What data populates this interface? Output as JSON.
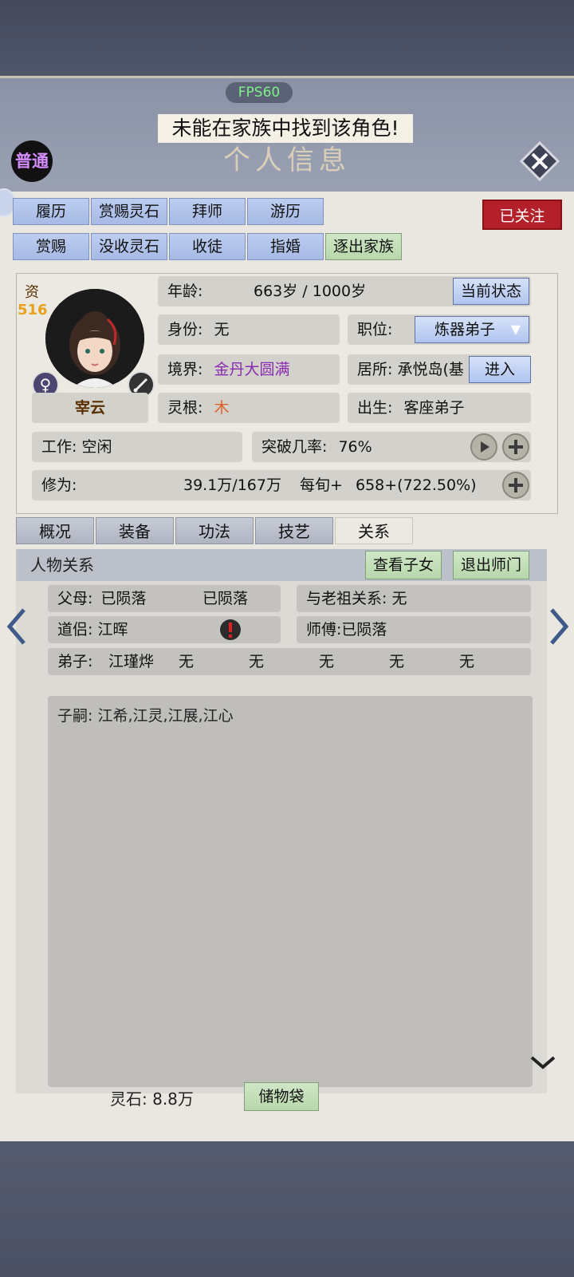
{
  "fps": "FPS60",
  "toast": "未能在家族中找到该角色!",
  "title": "个人信息",
  "rank_badge": "普通",
  "followed_label": "已关注",
  "action_row1": [
    "履历",
    "赏赐灵石",
    "拜师",
    "游历"
  ],
  "action_row2": [
    "赏赐",
    "没收灵石",
    "收徒",
    "指婚",
    "逐出家族"
  ],
  "char": {
    "zi_label": "资",
    "zi_value": "516",
    "name": "宰云",
    "sex_icon": "♀",
    "age_label": "年龄:",
    "age_value": "663岁 / 1000岁",
    "status_btn": "当前状态",
    "identity_label": "身份:",
    "identity_value": "无",
    "position_label": "职位:",
    "position_value": "炼器弟子",
    "realm_label": "境界:",
    "realm_value": "金丹大圆满",
    "realm_color": "#8a2bb0",
    "residence_label": "居所:",
    "residence_value": "承悦岛(基",
    "enter_btn": "进入",
    "root_label": "灵根:",
    "root_value": "木",
    "root_color": "#e0602a",
    "birth_label": "出生:",
    "birth_value": "客座弟子",
    "work_label": "工作:",
    "work_value": "空闲",
    "breakthrough_label": "突破几率:",
    "breakthrough_value": "76%",
    "cultivation_label": "修为:",
    "cultivation_value": "39.1万/167万",
    "per_round": "每旬+",
    "per_round_value": "658+(722.50%)"
  },
  "tabs": [
    "概况",
    "装备",
    "功法",
    "技艺",
    "关系"
  ],
  "relations": {
    "title": "人物关系",
    "view_children_btn": "查看子女",
    "leave_master_btn": "退出师门",
    "parents_label": "父母:",
    "parent1": "已陨落",
    "parent2": "已陨落",
    "ancestor": "与老祖关系: 无",
    "partner_label": "道侣:",
    "partner": "江晖",
    "master": "师傅:已陨落",
    "disciples_label": "弟子:",
    "disciples": [
      "江瑾烨",
      "无",
      "无",
      "无",
      "无",
      "无"
    ],
    "heirs_label": "子嗣:",
    "heirs": "江希,江灵,江展,江心"
  },
  "spirit_stones": "灵石: 8.8万",
  "storage_btn": "储物袋"
}
